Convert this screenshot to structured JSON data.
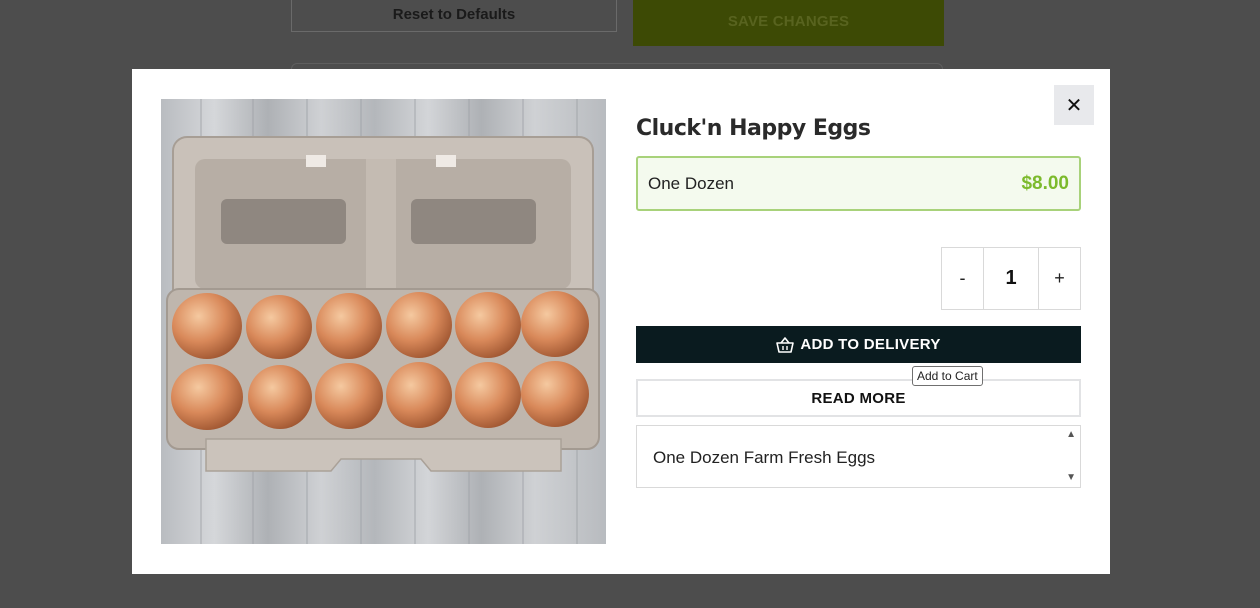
{
  "background": {
    "reset_label": "Reset to Defaults",
    "save_label": "SAVE CHANGES"
  },
  "modal": {
    "close_symbol": "✕",
    "product": {
      "title": "Cluck'n Happy Eggs",
      "image_icon": "egg-carton-photo",
      "variant": {
        "name": "One Dozen",
        "price": "$8.00"
      },
      "quantity": {
        "minus": "-",
        "value": "1",
        "plus": "+"
      },
      "add_button": {
        "icon": "basket-icon",
        "label": "ADD TO DELIVERY",
        "tooltip": "Add to Cart"
      },
      "read_more_label": "READ MORE",
      "description": "One Dozen Farm Fresh Eggs"
    }
  },
  "colors": {
    "overlay": "#4d4d4d",
    "accent_green": "#7cba2c",
    "button_dark": "#0a1b1f",
    "variant_border": "#a8d27a"
  }
}
